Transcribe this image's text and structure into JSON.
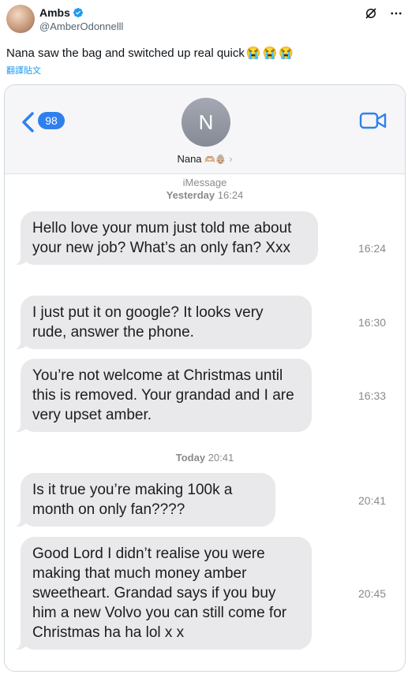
{
  "tweet": {
    "display_name": "Ambs",
    "handle": "@AmberOdonnelll",
    "text": "Nana saw the bag and switched up real quick",
    "emojis": [
      "😭",
      "😭",
      "😭"
    ],
    "translate_label": "翻譯貼文",
    "avatar_icon": "profile-photo",
    "verified_color": "#1d9bf0",
    "link_color": "#1d9bf0"
  },
  "phone": {
    "back_count": "98",
    "contact_initial": "N",
    "contact_name": "Nana",
    "contact_emojis": "🫶🏼👵🏼",
    "contact_chevron": "›",
    "service_label": "iMessage",
    "timestamp_1_day": "Yesterday",
    "timestamp_1_time": "16:24",
    "timestamp_2_day": "Today",
    "timestamp_2_time": "20:41",
    "accent_color": "#2f80ed",
    "bubble_color": "#e9e9eb"
  },
  "messages": [
    {
      "text": "Hello love your mum just told me about your new job? What’s an only fan? Xxx",
      "time": "16:24"
    },
    {
      "text": "I just put it on google? It looks very rude, answer the phone.",
      "time": "16:30"
    },
    {
      "text": "You’re not welcome at Christmas until this is removed. Your grandad and I are very upset amber.",
      "time": "16:33"
    },
    {
      "text": "Is it true you’re making 100k a month on only fan????",
      "time": "20:41"
    },
    {
      "text": "Good Lord I didn’t realise you were making that much money amber sweetheart. Grandad says if you buy him a new Volvo you can still come for Christmas ha ha lol x x",
      "time": "20:45"
    }
  ]
}
